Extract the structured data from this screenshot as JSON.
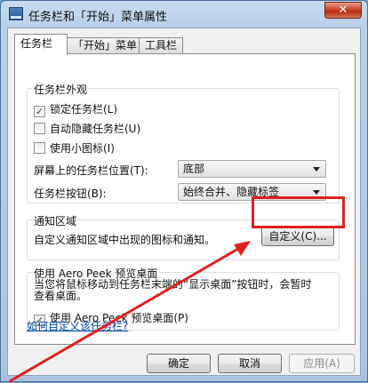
{
  "window": {
    "title": "任务栏和「开始」菜单属性",
    "close_glyph": "✕"
  },
  "tabs": [
    {
      "label": "任务栏",
      "active": true
    },
    {
      "label": "「开始」菜单",
      "active": false
    },
    {
      "label": "工具栏",
      "active": false
    }
  ],
  "appearance": {
    "title": "任务栏外观",
    "checkboxes": [
      {
        "label": "锁定任务栏(L)",
        "checked": true
      },
      {
        "label": "自动隐藏任务栏(U)",
        "checked": false
      },
      {
        "label": "使用小图标(I)",
        "checked": false
      }
    ],
    "location_label": "屏幕上的任务栏位置(T):",
    "location_value": "底部",
    "buttons_label": "任务栏按钮(B):",
    "buttons_value": "始终合并、隐藏标签"
  },
  "notification": {
    "title": "通知区域",
    "description": "自定义通知区域中出现的图标和通知。",
    "customize_button": "自定义(C)..."
  },
  "aero_peek": {
    "title": "使用 Aero Peek 预览桌面",
    "description": "当您将鼠标移动到任务栏末端的“显示桌面”按钮时，会暂时查看桌面。",
    "checkbox_label": "使用 Aero Peek 预览桌面(P)",
    "checked": true
  },
  "help_link": "如何自定义该任务栏?",
  "footer": {
    "ok": "确定",
    "cancel": "取消",
    "apply": "应用(A)"
  },
  "colors": {
    "annotation": "#e02020"
  }
}
